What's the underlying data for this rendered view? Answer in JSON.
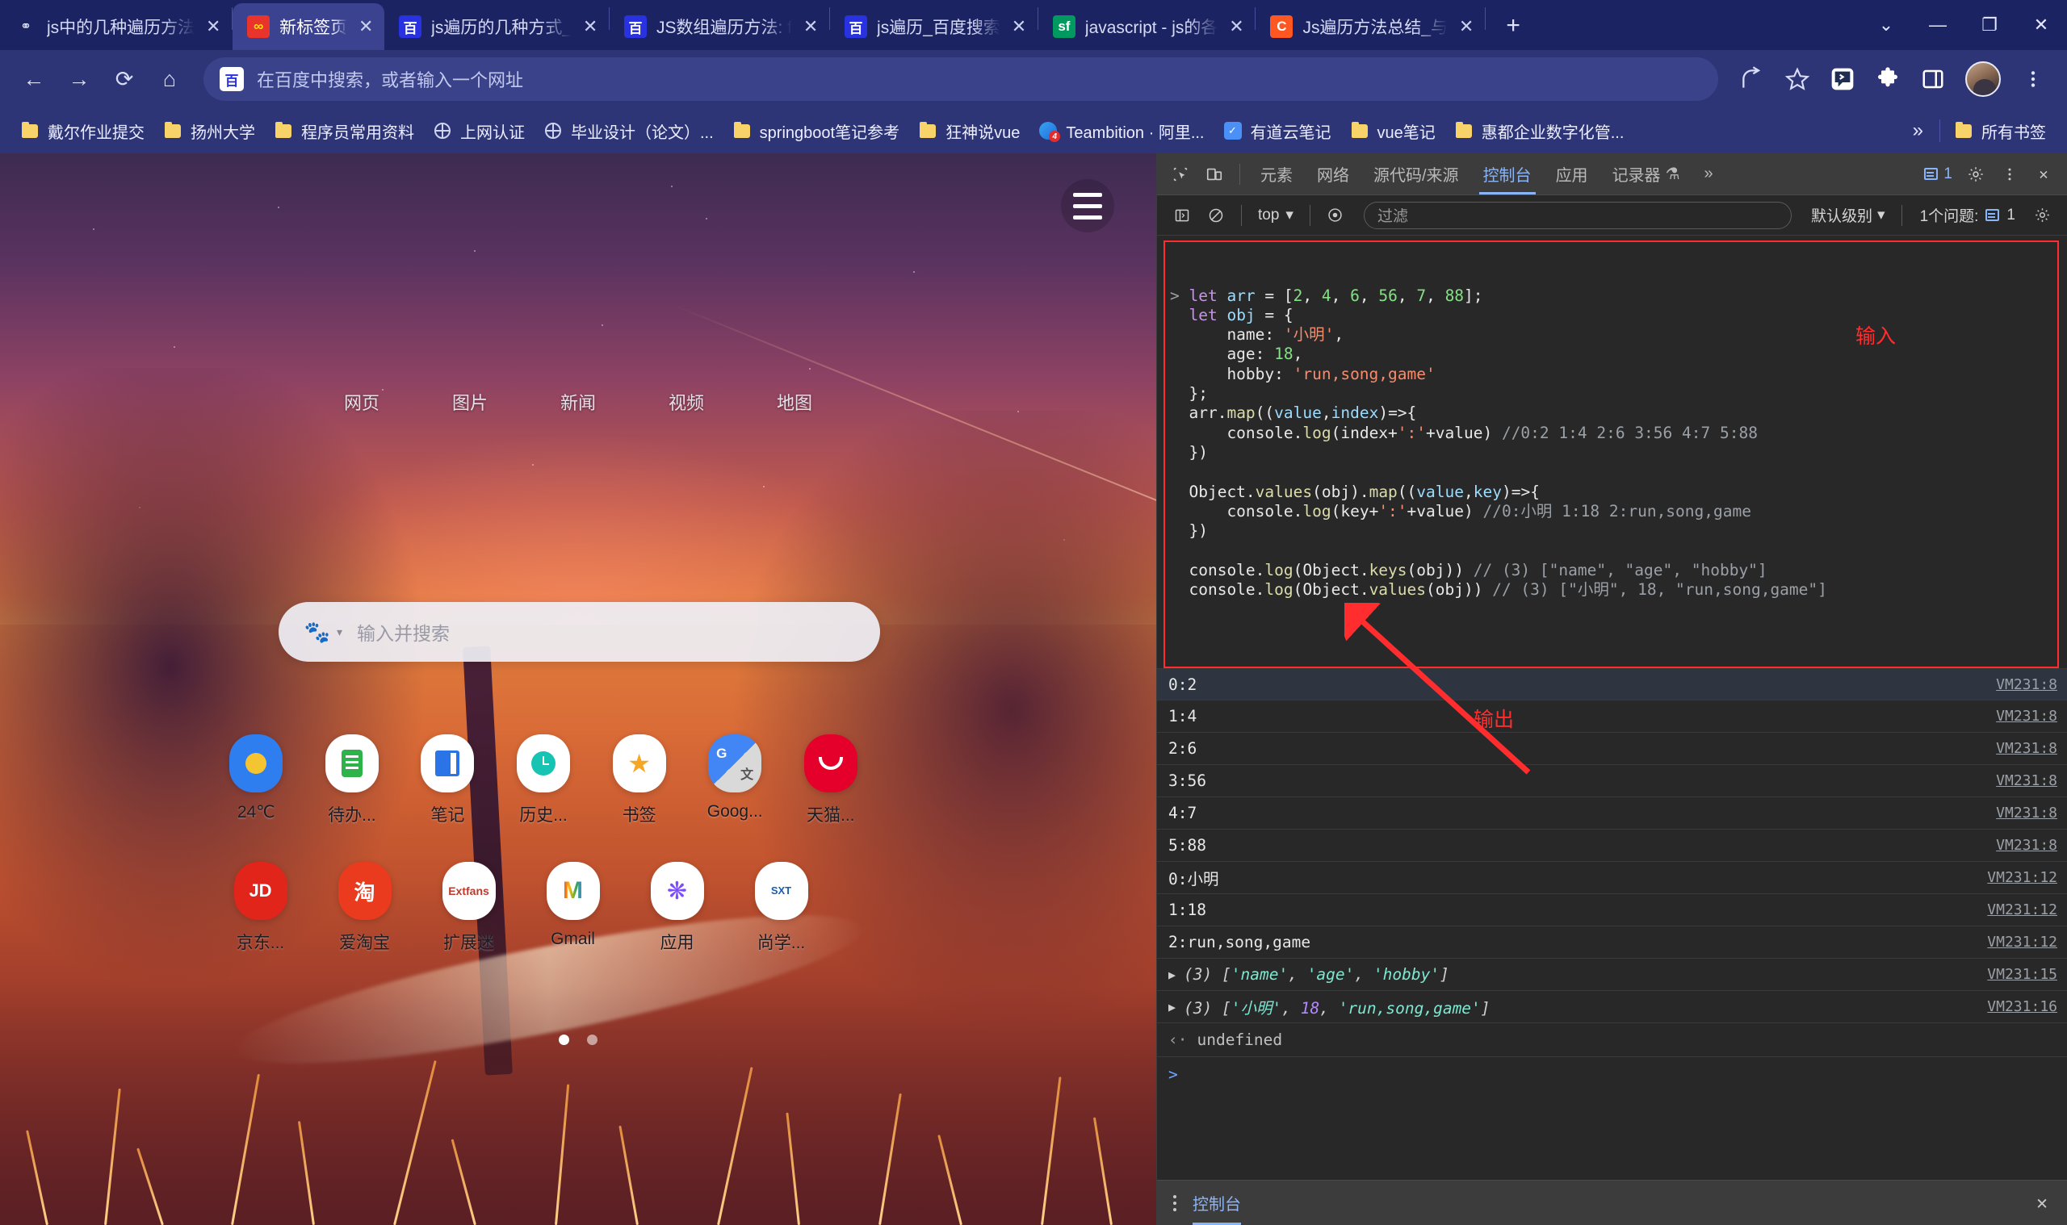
{
  "browser": {
    "tabs": [
      {
        "title": "js中的几种遍历方法",
        "favicon": "quora-icon",
        "active": false
      },
      {
        "title": "新标签页",
        "favicon": "infinity-icon",
        "active": true
      },
      {
        "title": "js遍历的几种方式_",
        "favicon": "baidu-icon",
        "active": false
      },
      {
        "title": "JS数组遍历方法: f",
        "favicon": "baidu-icon",
        "active": false
      },
      {
        "title": "js遍历_百度搜索",
        "favicon": "baidu-icon",
        "active": false
      },
      {
        "title": "javascript - js的各",
        "favicon": "segmentfault-icon",
        "active": false
      },
      {
        "title": "Js遍历方法总结_与",
        "favicon": "csdn-icon",
        "active": false
      }
    ],
    "new_tab_label": "+",
    "window_controls": [
      "⌄",
      "—",
      "❐",
      "✕"
    ],
    "nav": {
      "back": "←",
      "forward": "→",
      "reload": "⟳",
      "home": "⌂"
    },
    "omnibox": {
      "placeholder": "在百度中搜索，或者输入一个网址",
      "icon": "baidu-icon"
    },
    "toolbar_icons": [
      "share-icon",
      "star-icon",
      "extension-badge-icon",
      "puzzle-icon",
      "sidepanel-icon",
      "avatar",
      "kebab-menu-icon"
    ],
    "bookmarks": [
      {
        "label": "戴尔作业提交",
        "icon": "folder-icon"
      },
      {
        "label": "扬州大学",
        "icon": "folder-icon"
      },
      {
        "label": "程序员常用资料",
        "icon": "folder-icon"
      },
      {
        "label": "上网认证",
        "icon": "globe-icon"
      },
      {
        "label": "毕业设计（论文）...",
        "icon": "globe-icon"
      },
      {
        "label": "springboot笔记参考",
        "icon": "folder-icon"
      },
      {
        "label": "狂神说vue",
        "icon": "folder-icon"
      },
      {
        "label": "Teambition · 阿里...",
        "icon": "teambition-icon"
      },
      {
        "label": "有道云笔记",
        "icon": "youdao-icon"
      },
      {
        "label": "vue笔记",
        "icon": "folder-icon"
      },
      {
        "label": "惠都企业数字化管...",
        "icon": "folder-icon"
      }
    ],
    "bookmarks_overflow": "»",
    "all_bookmarks_label": "所有书签",
    "all_bookmarks_icon": "folder-icon"
  },
  "newtab": {
    "menu_icon": "hamburger-menu-icon",
    "categories": [
      "网页",
      "图片",
      "新闻",
      "视频",
      "地图"
    ],
    "search": {
      "placeholder": "输入并搜索",
      "logo": "baidu-paw-icon",
      "caret": "▾"
    },
    "shortcuts_row1": [
      {
        "label": "24℃",
        "icon": "weather-icon"
      },
      {
        "label": "待办...",
        "icon": "todo-icon"
      },
      {
        "label": "笔记",
        "icon": "note-icon"
      },
      {
        "label": "历史...",
        "icon": "history-clock-icon"
      },
      {
        "label": "书签",
        "icon": "star-icon"
      },
      {
        "label": "Goog...",
        "icon": "google-translate-icon"
      },
      {
        "label": "天猫...",
        "icon": "tmall-icon"
      }
    ],
    "shortcuts_row2": [
      {
        "label": "京东...",
        "icon": "jd-icon",
        "glyph": "JD"
      },
      {
        "label": "爱淘宝",
        "icon": "taobao-icon",
        "glyph": "淘"
      },
      {
        "label": "扩展迷",
        "icon": "extfans-icon",
        "glyph": "Extfans"
      },
      {
        "label": "Gmail",
        "icon": "gmail-icon",
        "glyph": "M"
      },
      {
        "label": "应用",
        "icon": "apps-icon",
        "glyph": "❋"
      },
      {
        "label": "尚学...",
        "icon": "sxt-icon",
        "glyph": "SXT"
      }
    ],
    "page_dots": 2,
    "active_dot": 0
  },
  "devtools": {
    "panel_icons": [
      "inspect-element-icon",
      "device-toolbar-icon"
    ],
    "tabs": [
      {
        "label": "元素",
        "active": false
      },
      {
        "label": "网络",
        "active": false
      },
      {
        "label": "源代码/来源",
        "active": false
      },
      {
        "label": "控制台",
        "active": true
      },
      {
        "label": "应用",
        "active": false
      },
      {
        "label": "记录器",
        "active": false
      }
    ],
    "recorder_beaker": "⚗",
    "more_tabs": "»",
    "issue_badge_count": "1",
    "settings_icon": "gear-icon",
    "kebab_icon": "kebab-menu-icon",
    "close_icon": "close-icon",
    "filterbar": {
      "sidebar_toggle_icon": "sidebar-toggle-icon",
      "clear_icon": "clear-console-icon",
      "context": "top",
      "context_caret": "▾",
      "eye_icon": "live-expression-icon",
      "filter_placeholder": "过滤",
      "level": "默认级别",
      "level_caret": "▾",
      "issues_label": "1个问题:",
      "issues_count": "1",
      "settings_icon": "gear-icon"
    },
    "console_input": {
      "prompt": ">",
      "lines": [
        [
          {
            "t": "let ",
            "c": "kw"
          },
          {
            "t": "arr",
            "c": "var"
          },
          {
            "t": " = [",
            "c": "pl"
          },
          {
            "t": "2",
            "c": "num"
          },
          {
            "t": ", ",
            "c": "pl"
          },
          {
            "t": "4",
            "c": "num"
          },
          {
            "t": ", ",
            "c": "pl"
          },
          {
            "t": "6",
            "c": "num"
          },
          {
            "t": ", ",
            "c": "pl"
          },
          {
            "t": "56",
            "c": "num"
          },
          {
            "t": ", ",
            "c": "pl"
          },
          {
            "t": "7",
            "c": "num"
          },
          {
            "t": ", ",
            "c": "pl"
          },
          {
            "t": "88",
            "c": "num"
          },
          {
            "t": "];",
            "c": "pl"
          }
        ],
        [
          {
            "t": "let ",
            "c": "kw"
          },
          {
            "t": "obj",
            "c": "var"
          },
          {
            "t": " = {",
            "c": "pl"
          }
        ],
        [
          {
            "t": "    name: ",
            "c": "pl"
          },
          {
            "t": "'小明'",
            "c": "str"
          },
          {
            "t": ",",
            "c": "pl"
          }
        ],
        [
          {
            "t": "    age: ",
            "c": "pl"
          },
          {
            "t": "18",
            "c": "num"
          },
          {
            "t": ",",
            "c": "pl"
          }
        ],
        [
          {
            "t": "    hobby: ",
            "c": "pl"
          },
          {
            "t": "'run,song,game'",
            "c": "str"
          }
        ],
        [
          {
            "t": "};",
            "c": "pl"
          }
        ],
        [
          {
            "t": "arr.",
            "c": "pl"
          },
          {
            "t": "map",
            "c": "fn"
          },
          {
            "t": "((",
            "c": "pl"
          },
          {
            "t": "value",
            "c": "var"
          },
          {
            "t": ",",
            "c": "pl"
          },
          {
            "t": "index",
            "c": "var"
          },
          {
            "t": ")=>{",
            "c": "pl"
          }
        ],
        [
          {
            "t": "    console.",
            "c": "pl"
          },
          {
            "t": "log",
            "c": "fn"
          },
          {
            "t": "(index+",
            "c": "pl"
          },
          {
            "t": "':'",
            "c": "str"
          },
          {
            "t": "+value) ",
            "c": "pl"
          },
          {
            "t": "//0:2 1:4 2:6 3:56 4:7 5:88",
            "c": "cm"
          }
        ],
        [
          {
            "t": "})",
            "c": "pl"
          }
        ],
        [
          {
            "t": "",
            "c": "pl"
          }
        ],
        [
          {
            "t": "Object.",
            "c": "pl"
          },
          {
            "t": "values",
            "c": "fn"
          },
          {
            "t": "(obj).",
            "c": "pl"
          },
          {
            "t": "map",
            "c": "fn"
          },
          {
            "t": "((",
            "c": "pl"
          },
          {
            "t": "value",
            "c": "var"
          },
          {
            "t": ",",
            "c": "pl"
          },
          {
            "t": "key",
            "c": "var"
          },
          {
            "t": ")=>{",
            "c": "pl"
          }
        ],
        [
          {
            "t": "    console.",
            "c": "pl"
          },
          {
            "t": "log",
            "c": "fn"
          },
          {
            "t": "(key+",
            "c": "pl"
          },
          {
            "t": "':'",
            "c": "str"
          },
          {
            "t": "+value) ",
            "c": "pl"
          },
          {
            "t": "//0:小明 1:18 2:run,song,game",
            "c": "cm"
          }
        ],
        [
          {
            "t": "})",
            "c": "pl"
          }
        ],
        [
          {
            "t": "",
            "c": "pl"
          }
        ],
        [
          {
            "t": "console.",
            "c": "pl"
          },
          {
            "t": "log",
            "c": "fn"
          },
          {
            "t": "(Object.",
            "c": "pl"
          },
          {
            "t": "keys",
            "c": "fn"
          },
          {
            "t": "(obj)) ",
            "c": "pl"
          },
          {
            "t": "// (3) [\"name\", \"age\", \"hobby\"]",
            "c": "cm"
          }
        ],
        [
          {
            "t": "console.",
            "c": "pl"
          },
          {
            "t": "log",
            "c": "fn"
          },
          {
            "t": "(Object.",
            "c": "pl"
          },
          {
            "t": "values",
            "c": "fn"
          },
          {
            "t": "(obj)) ",
            "c": "pl"
          },
          {
            "t": "// (3) [\"小明\", 18, \"run,song,game\"]",
            "c": "cm"
          }
        ]
      ]
    },
    "annotation_input": "输入",
    "annotation_output": "输出",
    "logs": [
      {
        "text": "0:2",
        "source": "VM231:8",
        "expandable": false
      },
      {
        "text": "1:4",
        "source": "VM231:8",
        "expandable": false
      },
      {
        "text": "2:6",
        "source": "VM231:8",
        "expandable": false
      },
      {
        "text": "3:56",
        "source": "VM231:8",
        "expandable": false
      },
      {
        "text": "4:7",
        "source": "VM231:8",
        "expandable": false
      },
      {
        "text": "5:88",
        "source": "VM231:8",
        "expandable": false
      },
      {
        "text": "0:小明",
        "source": "VM231:12",
        "expandable": false
      },
      {
        "text": "1:18",
        "source": "VM231:12",
        "expandable": false
      },
      {
        "text": "2:run,song,game",
        "source": "VM231:12",
        "expandable": false
      },
      {
        "text": "(3) ['name', 'age', 'hobby']",
        "source": "VM231:15",
        "expandable": true
      },
      {
        "text": "(3) ['小明', 18, 'run,song,game']",
        "source": "VM231:16",
        "expandable": true
      }
    ],
    "return_value": "undefined",
    "return_marker": "‹·",
    "input_prompt": ">",
    "drawer": {
      "kebab": "kebab-menu-icon",
      "tab_label": "控制台",
      "close": "✕"
    }
  },
  "colors": {
    "chrome_frame": "#2d3577",
    "tab_strip": "#1c2363",
    "devtools_bg": "#282828",
    "devtools_header": "#3c3c3c",
    "accent_blue": "#8ab4f8",
    "annotation_red": "#ff2d2d"
  }
}
